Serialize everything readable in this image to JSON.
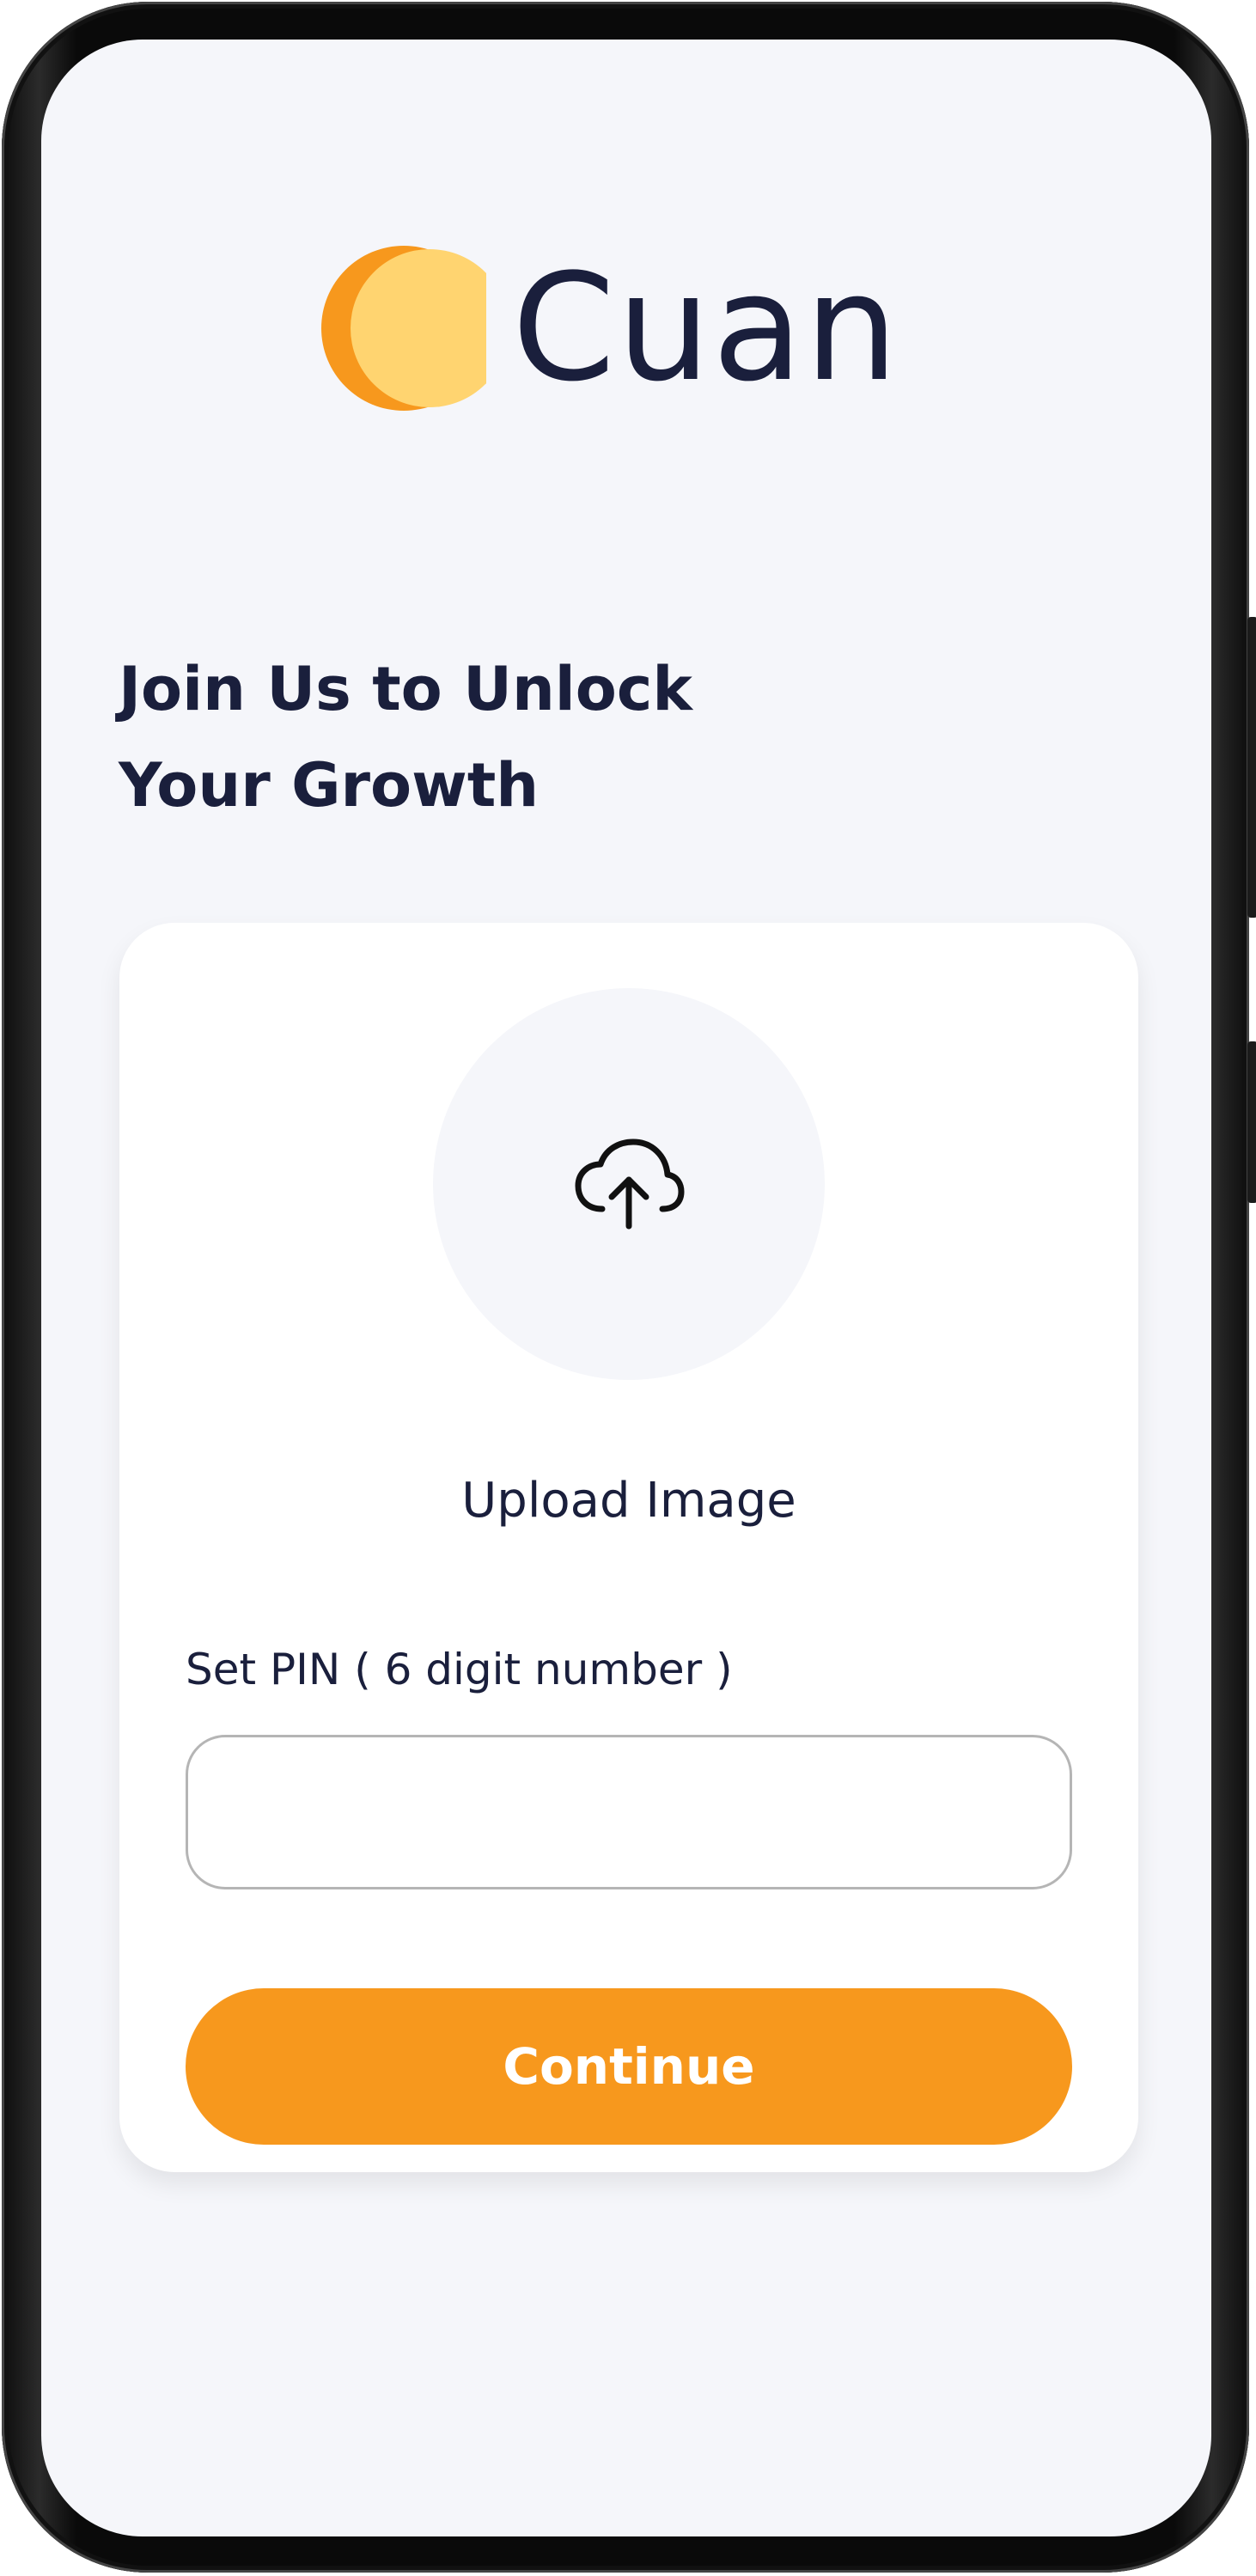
{
  "app": {
    "brand_name": "Cuan",
    "logo_icon": "crescent-moon-logo"
  },
  "colors": {
    "accent": "#f7981d",
    "logo_light": "#ffd470",
    "text_dark": "#1a1f3c",
    "background": "#f5f6fa"
  },
  "headline": {
    "line1": "Join Us to Unlock",
    "line2": "Your Growth"
  },
  "upload": {
    "icon": "cloud-upload-icon",
    "label": "Upload Image"
  },
  "pin": {
    "label": "Set PIN ( 6 digit number )",
    "value": "",
    "placeholder": ""
  },
  "actions": {
    "continue_label": "Continue"
  }
}
